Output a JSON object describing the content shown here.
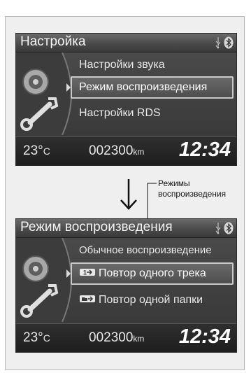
{
  "screen_settings": {
    "title": "Настройка",
    "menu": [
      {
        "label": "Настройки звука",
        "selected": false
      },
      {
        "label": "Режим воспроизведения",
        "selected": true
      },
      {
        "label": "Настройки RDS",
        "selected": false
      }
    ],
    "footer": {
      "temp_value": "23°",
      "temp_unit": "C",
      "odometer_value": "002300",
      "odometer_unit": "km",
      "clock": "12:34"
    }
  },
  "screen_play_mode": {
    "title": "Режим воспроизведения",
    "menu": [
      {
        "label": "Обычное воспроизведение",
        "selected": false,
        "icon": null
      },
      {
        "label": "Повтор одного трека",
        "selected": true,
        "icon": "repeat-track-icon"
      },
      {
        "label": "Повтор одной папки",
        "selected": false,
        "icon": "repeat-folder-icon"
      }
    ],
    "footer": {
      "temp_value": "23°",
      "temp_unit": "C",
      "odometer_value": "002300",
      "odometer_unit": "km",
      "clock": "12:34"
    }
  },
  "annotation": {
    "callout_line1": "Режимы",
    "callout_line2": "воспроизведения"
  },
  "icons": {
    "status": [
      "usb-icon",
      "bluetooth-icon"
    ],
    "left_art": [
      "disc-icon",
      "wrench-icon"
    ],
    "transition": "down-arrow-icon"
  },
  "colors": {
    "screen_bg": "#3a3a3a",
    "selection_border": "#c9c9c9",
    "text": "#e8e8e8"
  }
}
